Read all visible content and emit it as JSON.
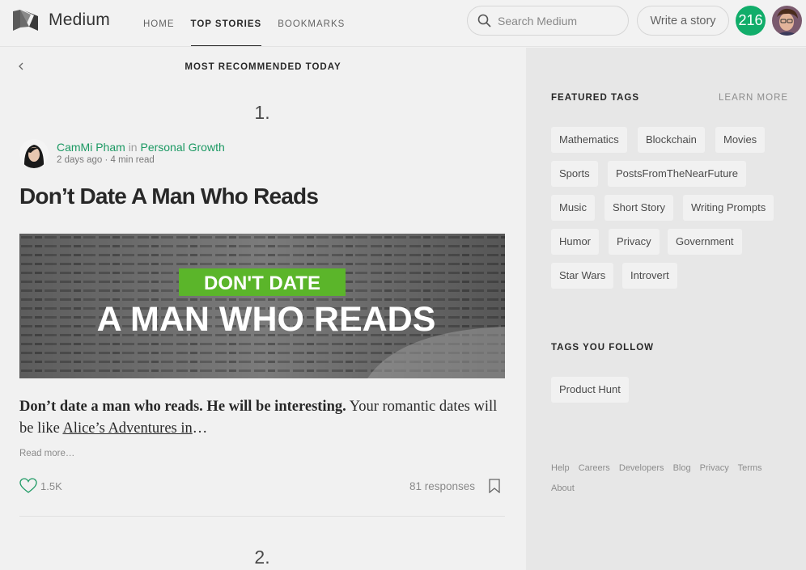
{
  "brand": {
    "name": "Medium"
  },
  "nav": {
    "items": [
      "HOME",
      "TOP STORIES",
      "BOOKMARKS"
    ],
    "active": "TOP STORIES"
  },
  "search": {
    "placeholder": "Search Medium"
  },
  "write_button": "Write a story",
  "notifications": {
    "count": "216",
    "color": "#11ad6a"
  },
  "main": {
    "section_title": "MOST RECOMMENDED TODAY",
    "stories": [
      {
        "rank": "1.",
        "author": "CamMi Pham",
        "in": "in",
        "publication": "Personal Growth",
        "meta": "2 days ago · 4 min read",
        "headline": "Don’t Date A Man Who Reads",
        "hero": {
          "badge": "DON'T DATE",
          "caption": "A MAN WHO READS",
          "badge_color": "#5bb52a"
        },
        "excerpt_bold": "Don’t date a man who reads. He will be interesting.",
        "excerpt_rest": " Your romantic dates will be like ",
        "excerpt_link": "Alice’s Adventures in",
        "excerpt_end": "…",
        "read_more": "Read more…",
        "likes": "1.5K",
        "responses": "81 responses"
      },
      {
        "rank": "2."
      }
    ]
  },
  "sidebar": {
    "featured_heading": "FEATURED TAGS",
    "learn_more": "LEARN MORE",
    "featured_tags": [
      "Mathematics",
      "Blockchain",
      "Movies",
      "Sports",
      "PostsFromTheNearFuture",
      "Music",
      "Short Story",
      "Writing Prompts",
      "Humor",
      "Privacy",
      "Government",
      "Star Wars",
      "Introvert"
    ],
    "follow_heading": "TAGS YOU FOLLOW",
    "followed_tags": [
      "Product Hunt"
    ],
    "footer_links": [
      "Help",
      "Careers",
      "Developers",
      "Blog",
      "Privacy",
      "Terms",
      "About"
    ]
  },
  "accent_color": "#1c9963"
}
